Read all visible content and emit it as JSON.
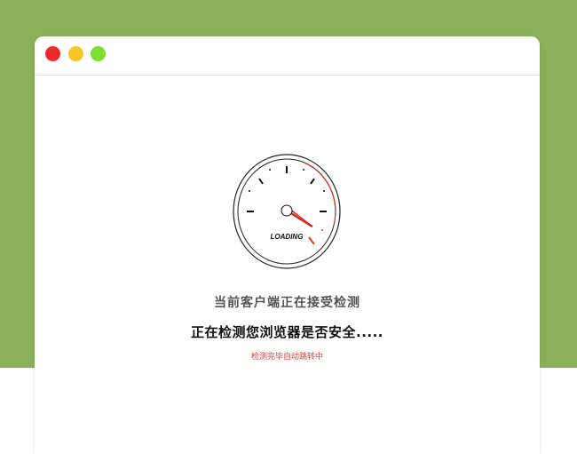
{
  "window": {
    "controls": [
      "close",
      "minimize",
      "maximize"
    ],
    "colors": {
      "close": "#ec2a2a",
      "minimize": "#f9c427",
      "maximize": "#7ede33"
    }
  },
  "gauge": {
    "label": "LOADING",
    "needle_color": "#e02020"
  },
  "status": {
    "line1": "当前客户端正在接受检测",
    "line2": "正在检测您浏览器是否安全.....",
    "line3": "检测完毕自动跳转中"
  },
  "background_color": "#8ab15a"
}
